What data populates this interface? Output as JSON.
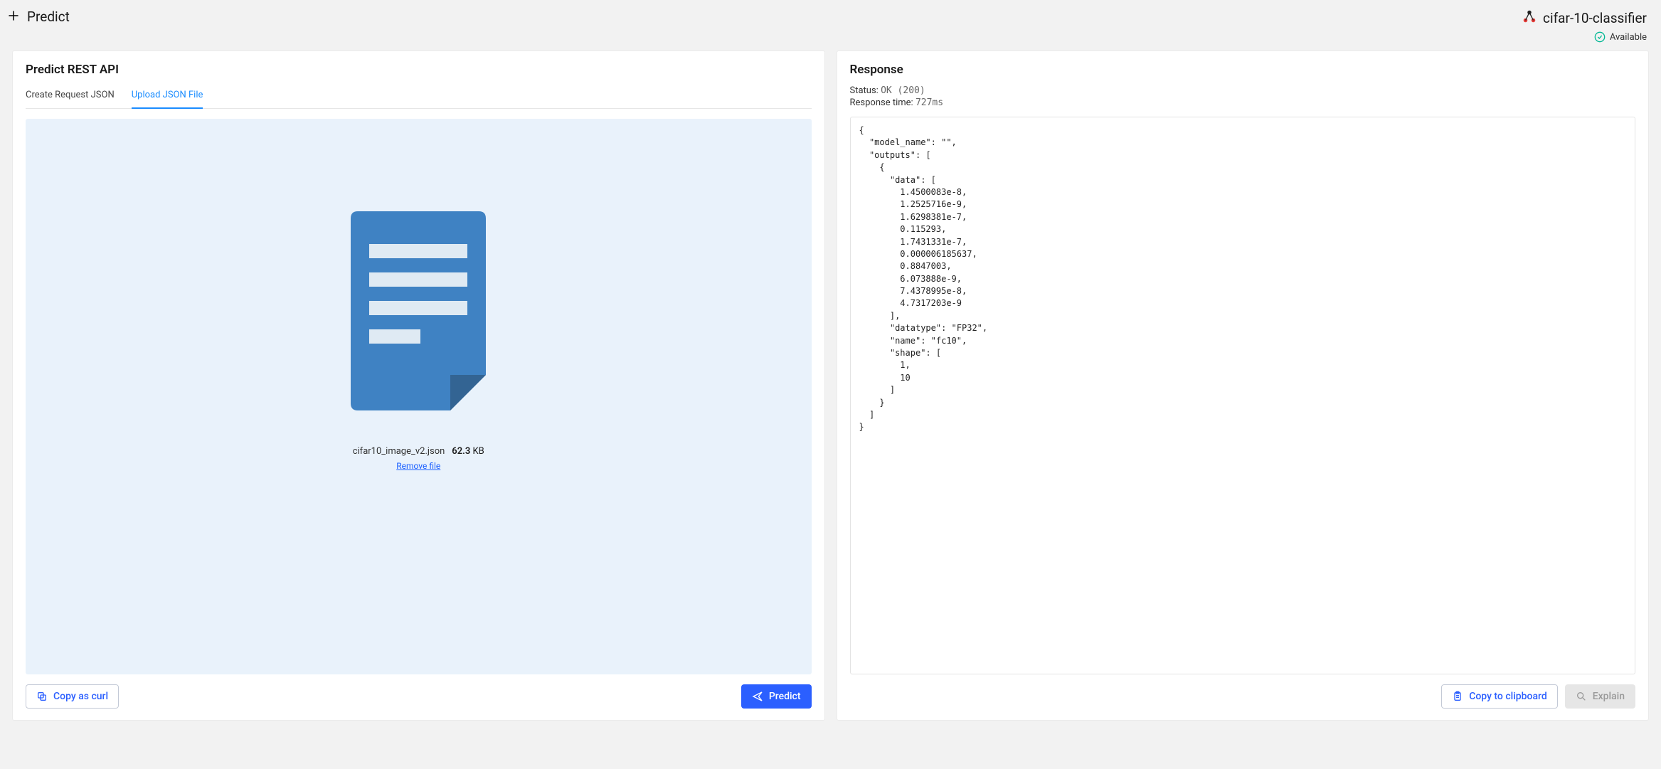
{
  "header": {
    "page_title": "Predict",
    "model_name": "cifar-10-classifier",
    "availability_label": "Available"
  },
  "left_panel": {
    "title": "Predict REST API",
    "tabs": [
      {
        "label": "Create Request JSON",
        "active": false
      },
      {
        "label": "Upload JSON File",
        "active": true
      }
    ],
    "uploaded_file": {
      "name": "cifar10_image_v2.json",
      "size_value": "62.3",
      "size_unit": "KB",
      "remove_label": "Remove file"
    },
    "copy_curl_label": "Copy as curl",
    "predict_button_label": "Predict"
  },
  "right_panel": {
    "title": "Response",
    "status_label": "Status:",
    "status_value": "OK (200)",
    "time_label": "Response time:",
    "time_value": "727ms",
    "body_text": "{\n  \"model_name\": \"\",\n  \"outputs\": [\n    {\n      \"data\": [\n        1.4500083e-8,\n        1.2525716e-9,\n        1.6298381e-7,\n        0.115293,\n        1.7431331e-7,\n        0.000006185637,\n        0.8847003,\n        6.073888e-9,\n        7.4378995e-8,\n        4.7317203e-9\n      ],\n      \"datatype\": \"FP32\",\n      \"name\": \"fc10\",\n      \"shape\": [\n        1,\n        10\n      ]\n    }\n  ]\n}",
    "copy_clipboard_label": "Copy to clipboard",
    "explain_label": "Explain"
  }
}
